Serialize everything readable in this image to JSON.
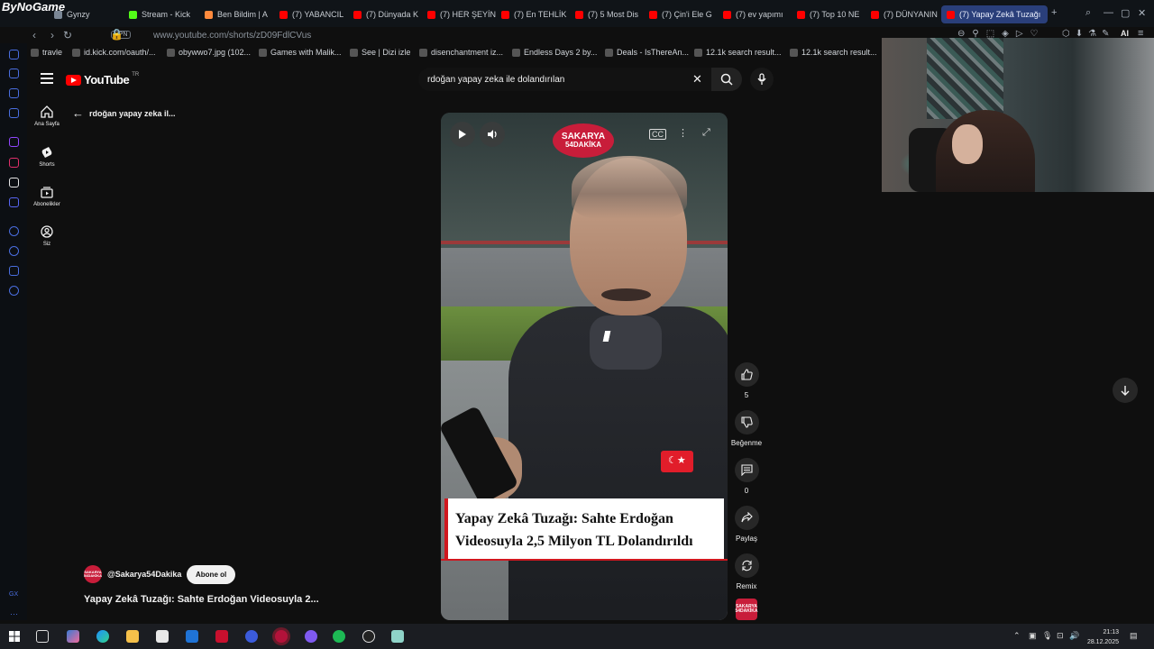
{
  "browser": {
    "brand": "ByNoGame",
    "tabs": [
      {
        "label": "Gynzy",
        "color": "#7b8796"
      },
      {
        "label": "Stream - Kick",
        "color": "#53fc18"
      },
      {
        "label": "Ben Bildim | A",
        "color": "#ff8a3d"
      },
      {
        "label": "(7) YABANCIL",
        "color": "#ff0000"
      },
      {
        "label": "(7) Dünyada K",
        "color": "#ff0000"
      },
      {
        "label": "(7) HER ŞEYİN",
        "color": "#ff0000"
      },
      {
        "label": "(7) En TEHLİK",
        "color": "#ff0000"
      },
      {
        "label": "(7) 5 Most Dis",
        "color": "#ff0000"
      },
      {
        "label": "(7) Çin'i Ele G",
        "color": "#ff0000"
      },
      {
        "label": "(7) ev yapımı",
        "color": "#ff0000"
      },
      {
        "label": "(7) Top 10 NE",
        "color": "#ff0000"
      },
      {
        "label": "(7) DÜNYANIN",
        "color": "#ff0000"
      },
      {
        "label": "(7) Yapay Zekâ Tuzağı",
        "color": "#ff0000",
        "active": true
      }
    ],
    "url": "www.youtube.com/shorts/zD09FdlCVus",
    "vpn_label": "VPN",
    "bookmarks": [
      "travle",
      "id.kick.com/oauth/...",
      "obywwo7.jpg (102...",
      "Games with Malik...",
      "See | Dizi izle",
      "disenchantment iz...",
      "Endless Days 2 by...",
      "Deals - IsThereAn...",
      "12.1k search result...",
      "12.1k search result..."
    ],
    "ai_label": "AI"
  },
  "youtube": {
    "logo_text": "YouTube",
    "logo_region": "TR",
    "search_value": "rdoğan yapay zeka ile dolandırılan",
    "nav": [
      {
        "label": "Ana Sayfa",
        "icon": "home-icon"
      },
      {
        "label": "Shorts",
        "icon": "shorts-icon"
      },
      {
        "label": "Abonelikler",
        "icon": "subscriptions-icon"
      },
      {
        "label": "Siz",
        "icon": "you-icon"
      }
    ],
    "back_label": "rdoğan yapay zeka il...",
    "video": {
      "logo_line1": "SAKARYA",
      "logo_line2": "54DAKİKA",
      "caption": "Yapay Zekâ Tuzağı: Sahte Erdoğan Videosuyla 2,5 Milyon TL Dolandırıldı"
    },
    "actions": {
      "like_count": "5",
      "dislike_label": "Beğenme",
      "comment_count": "0",
      "share_label": "Paylaş",
      "remix_label": "Remix"
    },
    "channel": {
      "handle": "@Sakarya54Dakika",
      "subscribe_label": "Abone ol",
      "avatar_text": "SAKARYA 54DAKİKA"
    },
    "video_title": "Yapay Zekâ Tuzağı: Sahte Erdoğan Videosuyla 2..."
  },
  "taskbar": {
    "time": "21:13",
    "date": "28.12.2025"
  }
}
